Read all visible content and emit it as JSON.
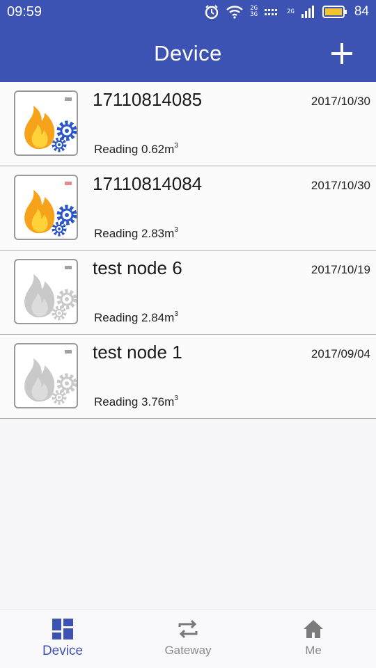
{
  "status_bar": {
    "time": "09:59",
    "network_top": "2G",
    "network_bottom": "3G",
    "network2": "2G",
    "battery_level": "84"
  },
  "header": {
    "title": "Device"
  },
  "devices": [
    {
      "name": "17110814085",
      "date": "2017/10/30",
      "reading_label": "Reading 0.62m",
      "reading_unit_sup": "3",
      "online": true,
      "led_color": "#a0a0a0"
    },
    {
      "name": "17110814084",
      "date": "2017/10/30",
      "reading_label": "Reading 2.83m",
      "reading_unit_sup": "3",
      "online": true,
      "led_color": "#e88a8a"
    },
    {
      "name": "test node 6",
      "date": "2017/10/19",
      "reading_label": "Reading 2.84m",
      "reading_unit_sup": "3",
      "online": false,
      "led_color": "#a0a0a0"
    },
    {
      "name": "test node 1",
      "date": "2017/09/04",
      "reading_label": "Reading 3.76m",
      "reading_unit_sup": "3",
      "online": false,
      "led_color": "#a0a0a0"
    }
  ],
  "tabs": [
    {
      "label": "Device",
      "icon": "dashboard-icon"
    },
    {
      "label": "Gateway",
      "icon": "swap-arrows-icon"
    },
    {
      "label": "Me",
      "icon": "home-icon"
    }
  ],
  "colors": {
    "accent": "#3d53b4",
    "flame_outer": "#f7a21b",
    "flame_inner": "#ffd23a",
    "gear_active": "#2c57c8",
    "inactive_gray": "#c9c9c9"
  }
}
